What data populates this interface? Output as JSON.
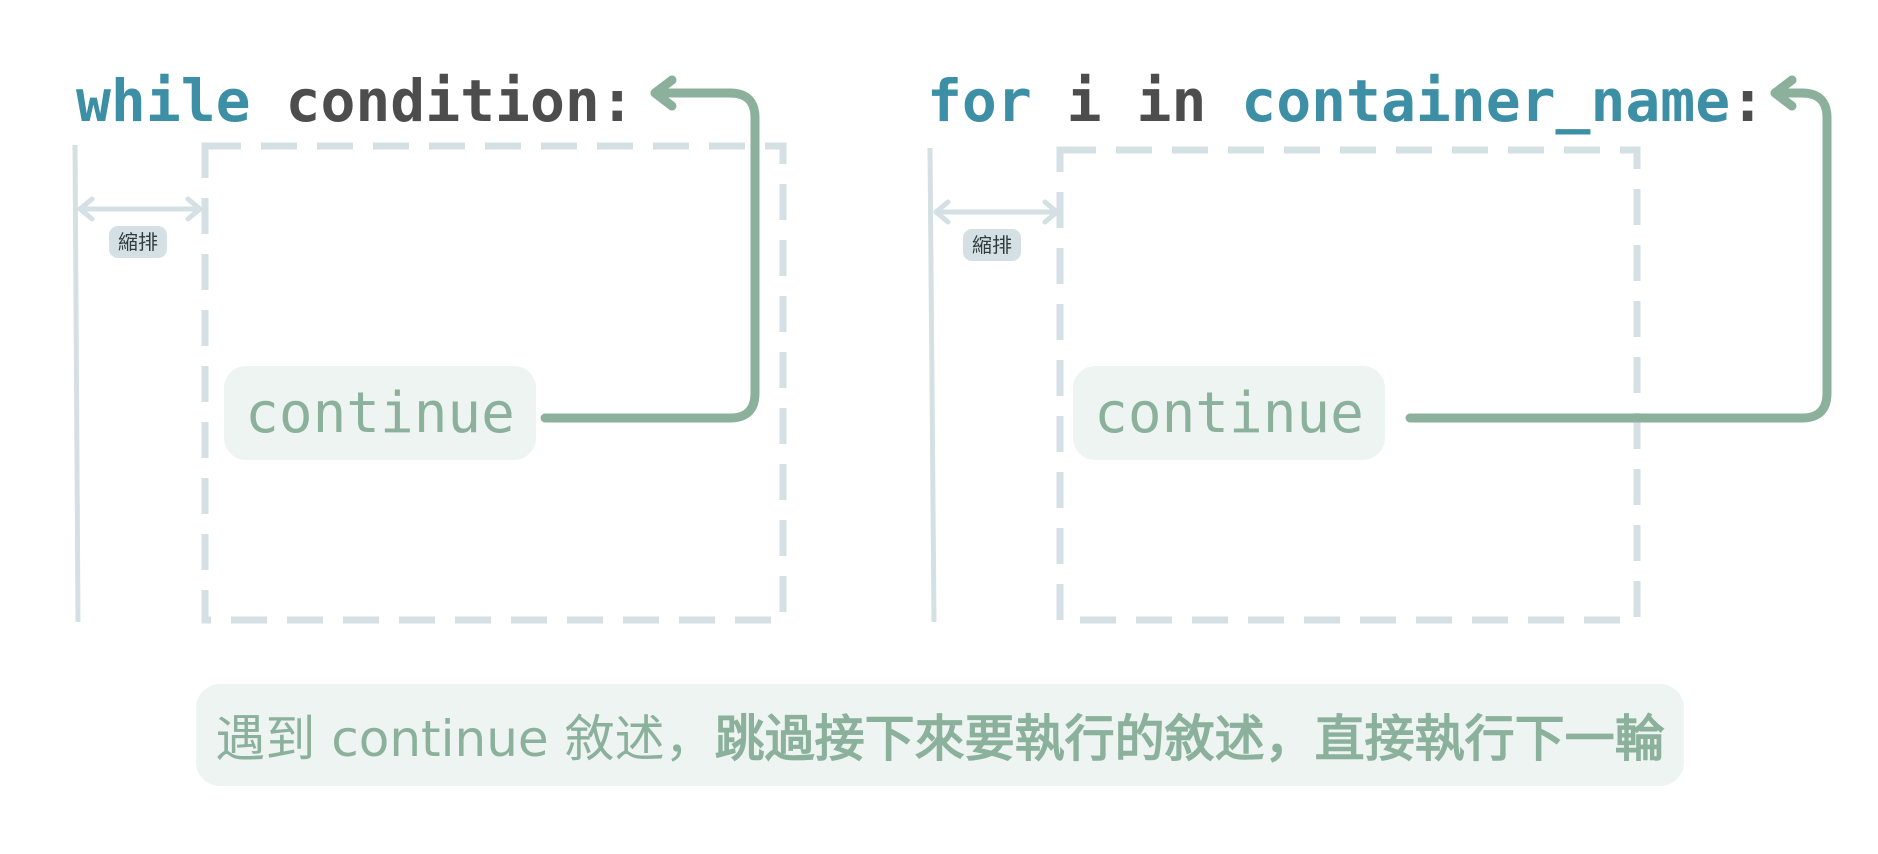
{
  "left_panel": {
    "keyword": "while",
    "rest": " condition:",
    "indent_label": "縮排",
    "continue_label": "continue"
  },
  "right_panel": {
    "keyword_for": "for",
    "middle": " i in ",
    "container": "container_name",
    "colon": ":",
    "indent_label": "縮排",
    "continue_label": "continue"
  },
  "caption": {
    "part1": "遇到 continue 敘述，",
    "part2": "跳過接下來要執行的敘述，直接執行下一輪"
  },
  "colors": {
    "keyword": "#3d8fa6",
    "text": "#4d4d4d",
    "arrow": "#8bb19c",
    "guide": "#d5e0e4",
    "box_bg": "#eef4f1"
  }
}
